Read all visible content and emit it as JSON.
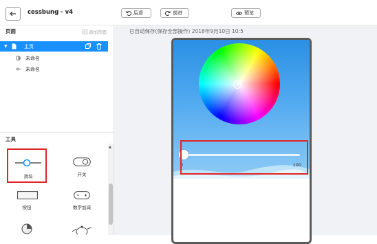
{
  "app": {
    "title": "cessbung - v4"
  },
  "toolbar": {
    "undo_label": "后退",
    "redo_label": "前进",
    "preview_label": "预览"
  },
  "pages_panel": {
    "title": "页面",
    "add_page_label": "添加页面",
    "selected_page": "主页",
    "sub_pages": [
      "未命名",
      "未命名"
    ]
  },
  "tools_panel": {
    "title": "工具",
    "items": [
      {
        "label": "滑块",
        "icon": "slider-icon",
        "selected": true
      },
      {
        "label": "开关",
        "icon": "toggle-switch-icon",
        "selected": false
      },
      {
        "label": "按钮",
        "icon": "button-icon",
        "selected": false
      },
      {
        "label": "数字加减",
        "icon": "number-stepper-icon",
        "selected": false
      },
      {
        "label": "",
        "icon": "pie-chart-icon",
        "selected": false
      },
      {
        "label": "",
        "icon": "teapot-icon",
        "selected": false
      }
    ]
  },
  "canvas": {
    "autosave_text": "已自动保存(保存全部操作) 2018年9月10日 10:5",
    "slider": {
      "min_label": "0",
      "max_label": "100",
      "value": 0
    }
  },
  "colors": {
    "accent": "#1890ff",
    "highlight": "#e02424"
  }
}
